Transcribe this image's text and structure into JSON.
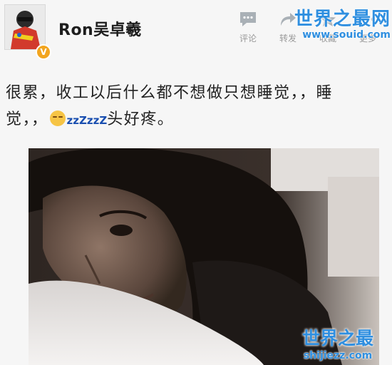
{
  "post": {
    "author": "Ron吴卓羲",
    "verified_badge": "V",
    "line1": "很累，收工以后什么都不想做只想睡觉，，睡",
    "line2_start": "觉，，",
    "emoji": "sleepy-face",
    "zzz": [
      "zzZ",
      "zzZ"
    ],
    "line2_end": "头好疼。"
  },
  "actions": [
    {
      "label": "评论",
      "icon": "comment-icon"
    },
    {
      "label": "转发",
      "icon": "repost-icon"
    },
    {
      "label": "收藏",
      "icon": "favorite-icon"
    },
    {
      "label": "更多",
      "icon": "more-icon"
    }
  ],
  "watermark_top": {
    "brand": "世界之最网",
    "url": "www.souid.com"
  },
  "watermark_bottom": {
    "brand": "世界之最",
    "url": "shijiezz.com"
  },
  "colors": {
    "watermark": "#2f8fe0",
    "badge": "#f2a51f"
  }
}
